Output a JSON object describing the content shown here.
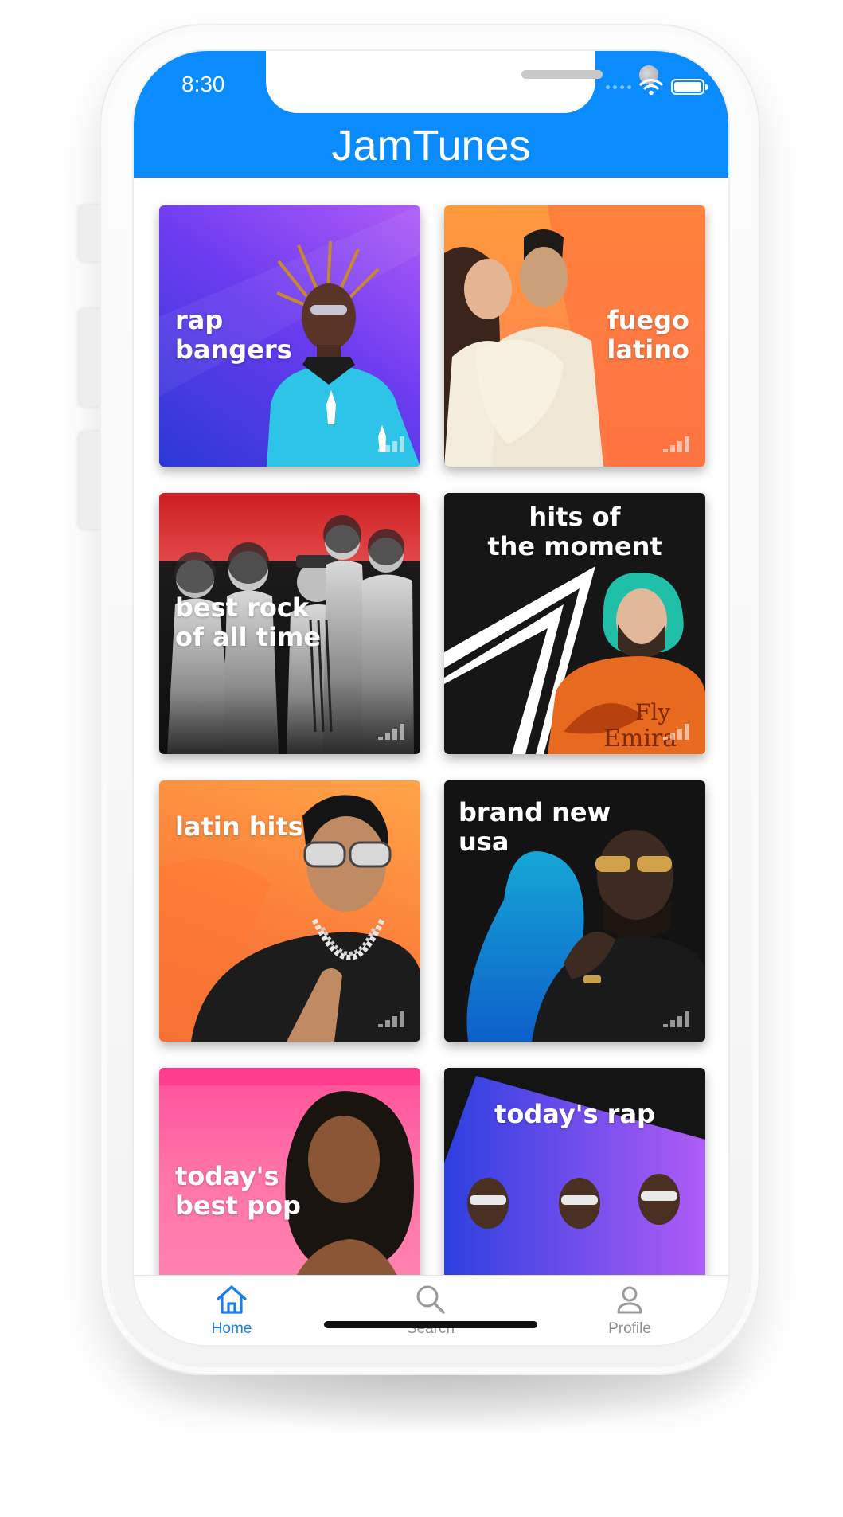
{
  "status": {
    "time": "8:30"
  },
  "app": {
    "title": "JamTunes"
  },
  "colors": {
    "header": "#0a8cff",
    "active_tab": "#1a7fe8",
    "inactive_tab": "#8e8e8e"
  },
  "playlists": [
    {
      "title": "rap\nbangers"
    },
    {
      "title": "fuego\nlatino"
    },
    {
      "title": "best rock\nof all time"
    },
    {
      "title": "hits of\nthe moment"
    },
    {
      "title": "latin hits"
    },
    {
      "title": "brand new\nusa"
    },
    {
      "title": "today's\nbest pop"
    },
    {
      "title": "today's rap"
    }
  ],
  "tabs": [
    {
      "label": "Home",
      "icon": "home-icon",
      "active": true
    },
    {
      "label": "Search",
      "icon": "search-icon",
      "active": false
    },
    {
      "label": "Profile",
      "icon": "person-icon",
      "active": false
    }
  ]
}
